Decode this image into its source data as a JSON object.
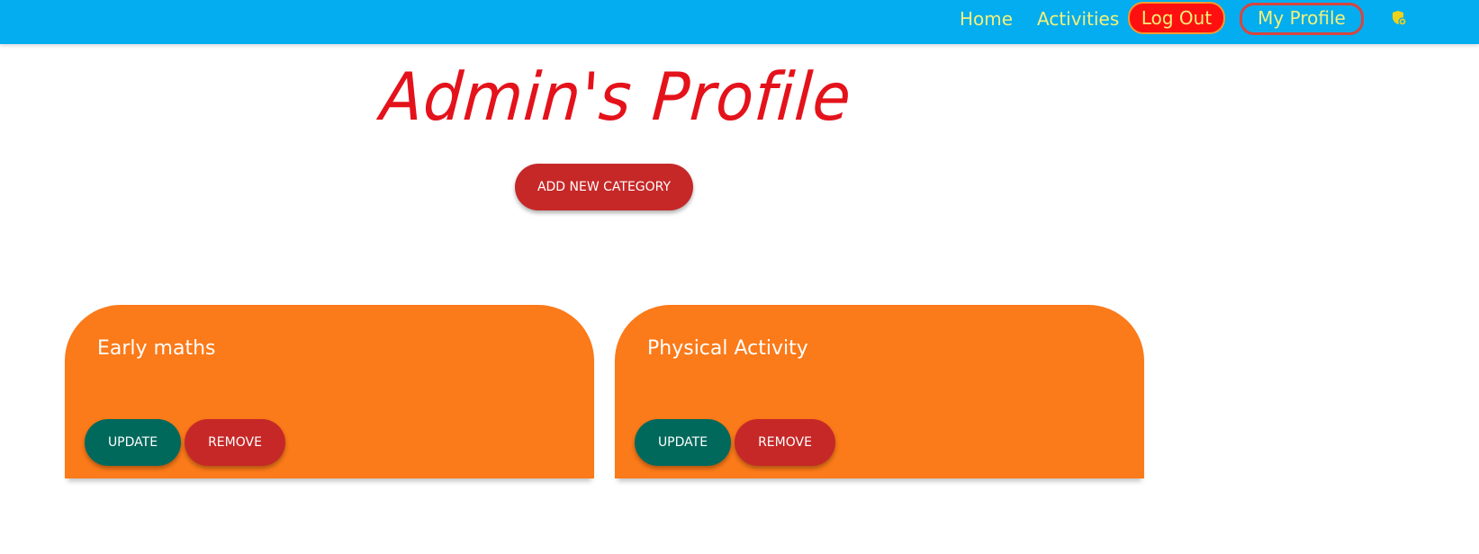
{
  "navbar": {
    "links": {
      "home": "Home",
      "activities": "Activities",
      "logout": "Log Out",
      "profile": "My Profile"
    },
    "extension_icon": "shield-badge-icon",
    "background_color": "#03adef",
    "link_color": "#f4f07a"
  },
  "page": {
    "title": "Admin's Profile",
    "title_color": "#e4121b",
    "add_button_label": "ADD NEW CATEGORY"
  },
  "categories": [
    {
      "name": "Early maths",
      "update_label": "UPDATE",
      "remove_label": "REMOVE"
    },
    {
      "name": "Physical Activity",
      "update_label": "UPDATE",
      "remove_label": "REMOVE"
    }
  ],
  "colors": {
    "card": "#fb7a19",
    "update_button": "#00695c",
    "remove_button": "#c62828"
  }
}
